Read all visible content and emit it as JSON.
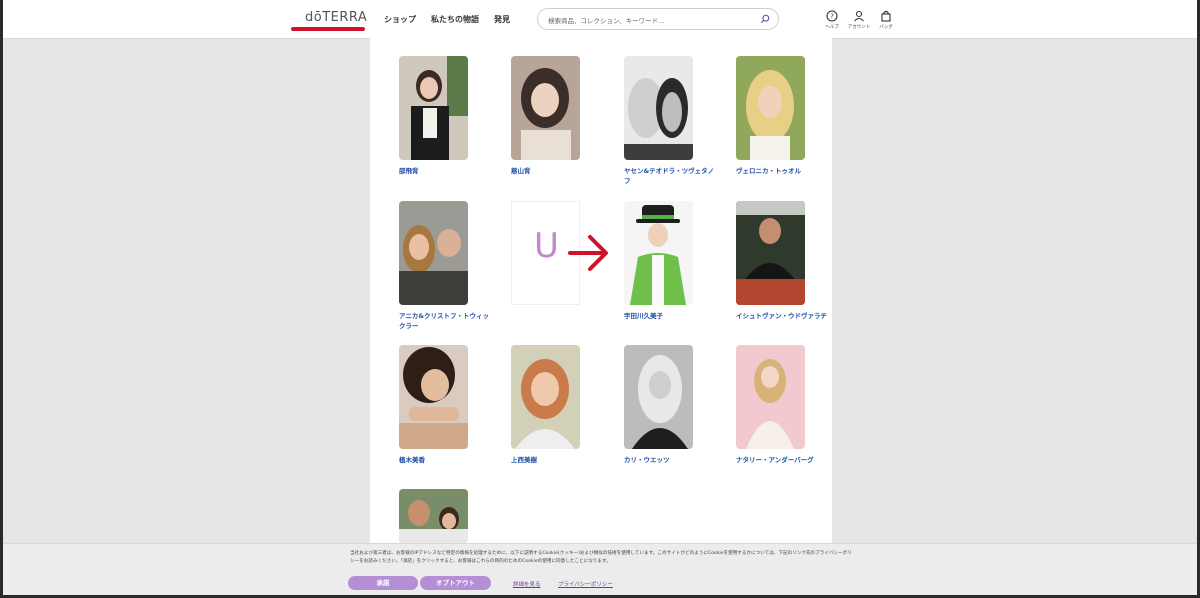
{
  "header": {
    "logo": "dōTERRA",
    "nav": [
      "ショップ",
      "私たちの物語",
      "発見"
    ],
    "search_placeholder": "検索商品、コレクション、キーワード...",
    "utilities": [
      {
        "icon": "help-icon",
        "label": "ヘルプ"
      },
      {
        "icon": "account-icon",
        "label": "アカウント"
      },
      {
        "icon": "bag-icon",
        "label": "バッグ"
      }
    ]
  },
  "people": [
    {
      "name": "邵飛背"
    },
    {
      "name": "慈山背"
    },
    {
      "name": "ヤセン&テオドラ・ツヴェタノフ"
    },
    {
      "name": "ヴェロニカ・トゥオル"
    },
    {
      "name": "アニカ&クリストフ・トウィックラー"
    },
    {
      "name": ""
    },
    {
      "name": "宇田川久美子"
    },
    {
      "name": "イシュトヴァン・ウドヴァラチ"
    },
    {
      "name": "植木美香"
    },
    {
      "name": "上西美樹"
    },
    {
      "name": "カリ・ウエッツ"
    },
    {
      "name": "ナタリー・アンダーバーグ"
    },
    {
      "name": ""
    }
  ],
  "placeholder_letter": "U",
  "cookie": {
    "text": "当社および第三者は、お客様のIPアドレスなど特定の情報を処理するために、以下に説明するCookie(クッキー)および類似の技術を使用しています。このサイトがどのようにCookieを使用するかについては、下記のリンク先のプライバシーポリシーをお読みください。「承諾」をクリックすると、お客様はこれらの目的のためのCookieの使用に同意したことになります。",
    "accept": "承諾",
    "optout": "オプトアウト",
    "details": "詳細を見る",
    "privacy": "プライバシーポリシー"
  },
  "colors": {
    "accent_red": "#d0132a",
    "button_purple": "#b48fd6",
    "name_blue": "#1e4fa3"
  }
}
